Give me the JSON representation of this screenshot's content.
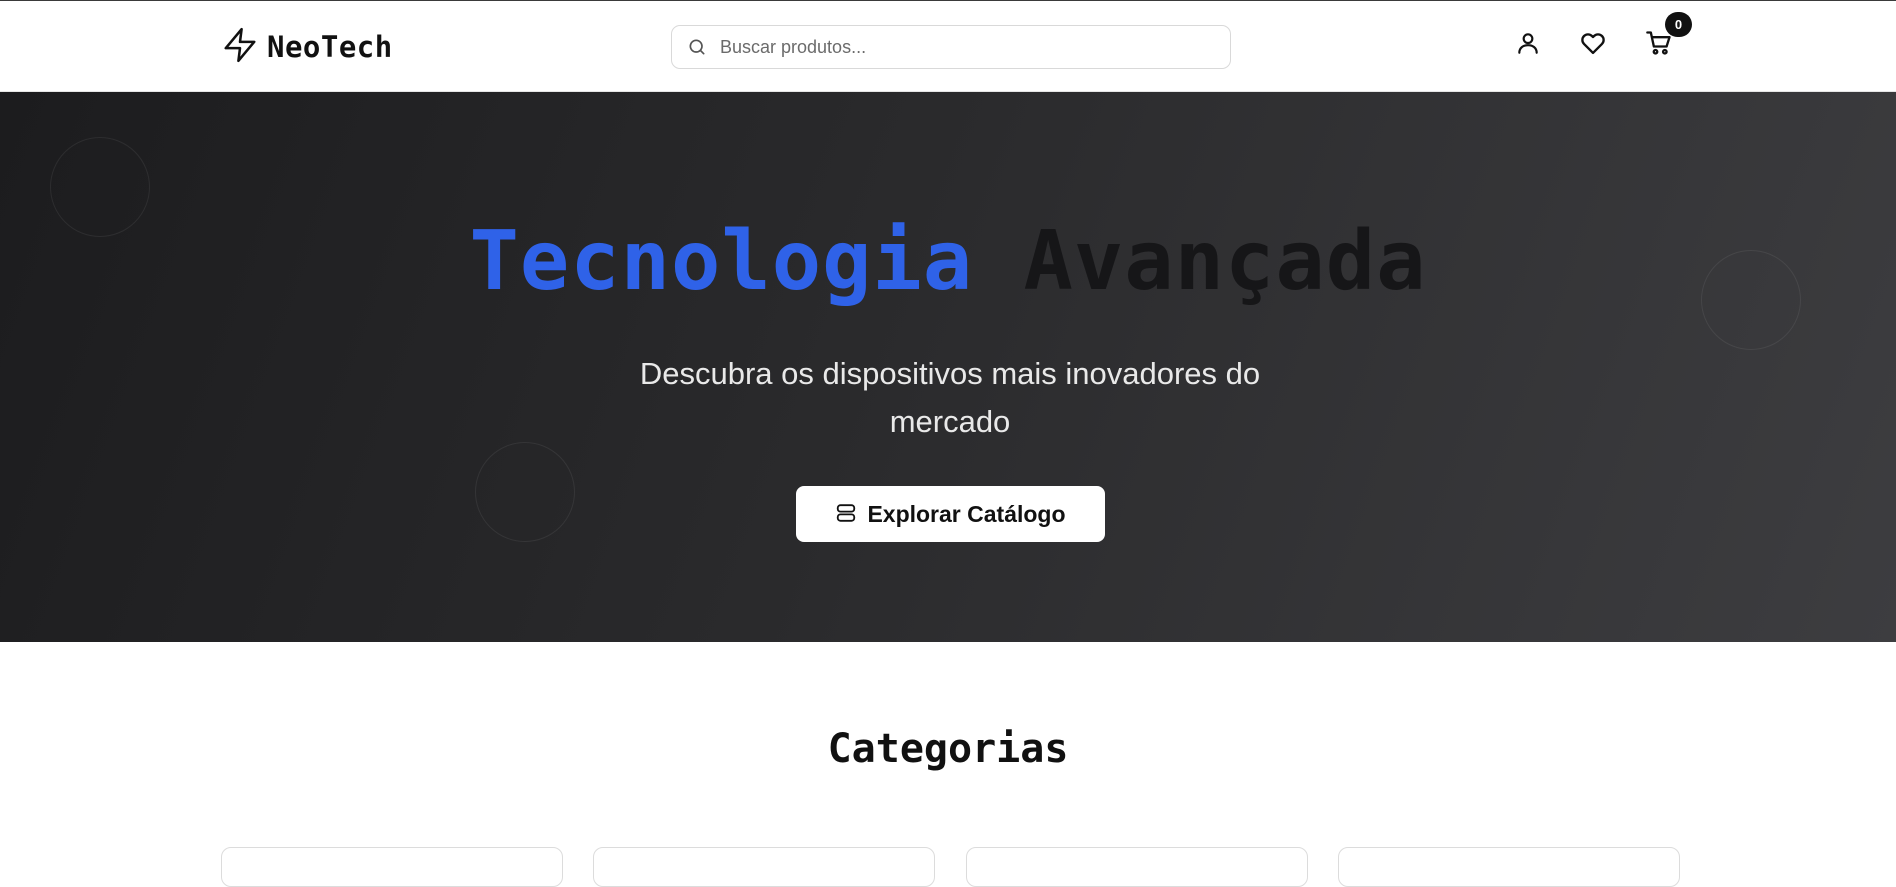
{
  "brand": {
    "name": "NeoTech",
    "logo_icon": "lightning-bolt-icon"
  },
  "search": {
    "placeholder": "Buscar produtos...",
    "value": "",
    "icon": "search-icon"
  },
  "header_actions": [
    {
      "name": "account",
      "icon": "user-icon"
    },
    {
      "name": "wishlist",
      "icon": "heart-icon"
    },
    {
      "name": "cart",
      "icon": "shopping-cart-icon"
    }
  ],
  "cart": {
    "count": "0"
  },
  "hero": {
    "title_part1": "Tecnologia",
    "title_part2": "Avançada",
    "subtitle": "Descubra os dispositivos mais inovadores do mercado",
    "cta_label": "Explorar Catálogo",
    "cta_icon": "catalog-stack-icon"
  },
  "categories": {
    "title": "Categorias"
  },
  "colors": {
    "accent": "#2f62e8",
    "hero_dark": "#1c1c1e",
    "hero_light": "#3d3d40",
    "text": "#111111",
    "border": "#d9d9d9"
  }
}
